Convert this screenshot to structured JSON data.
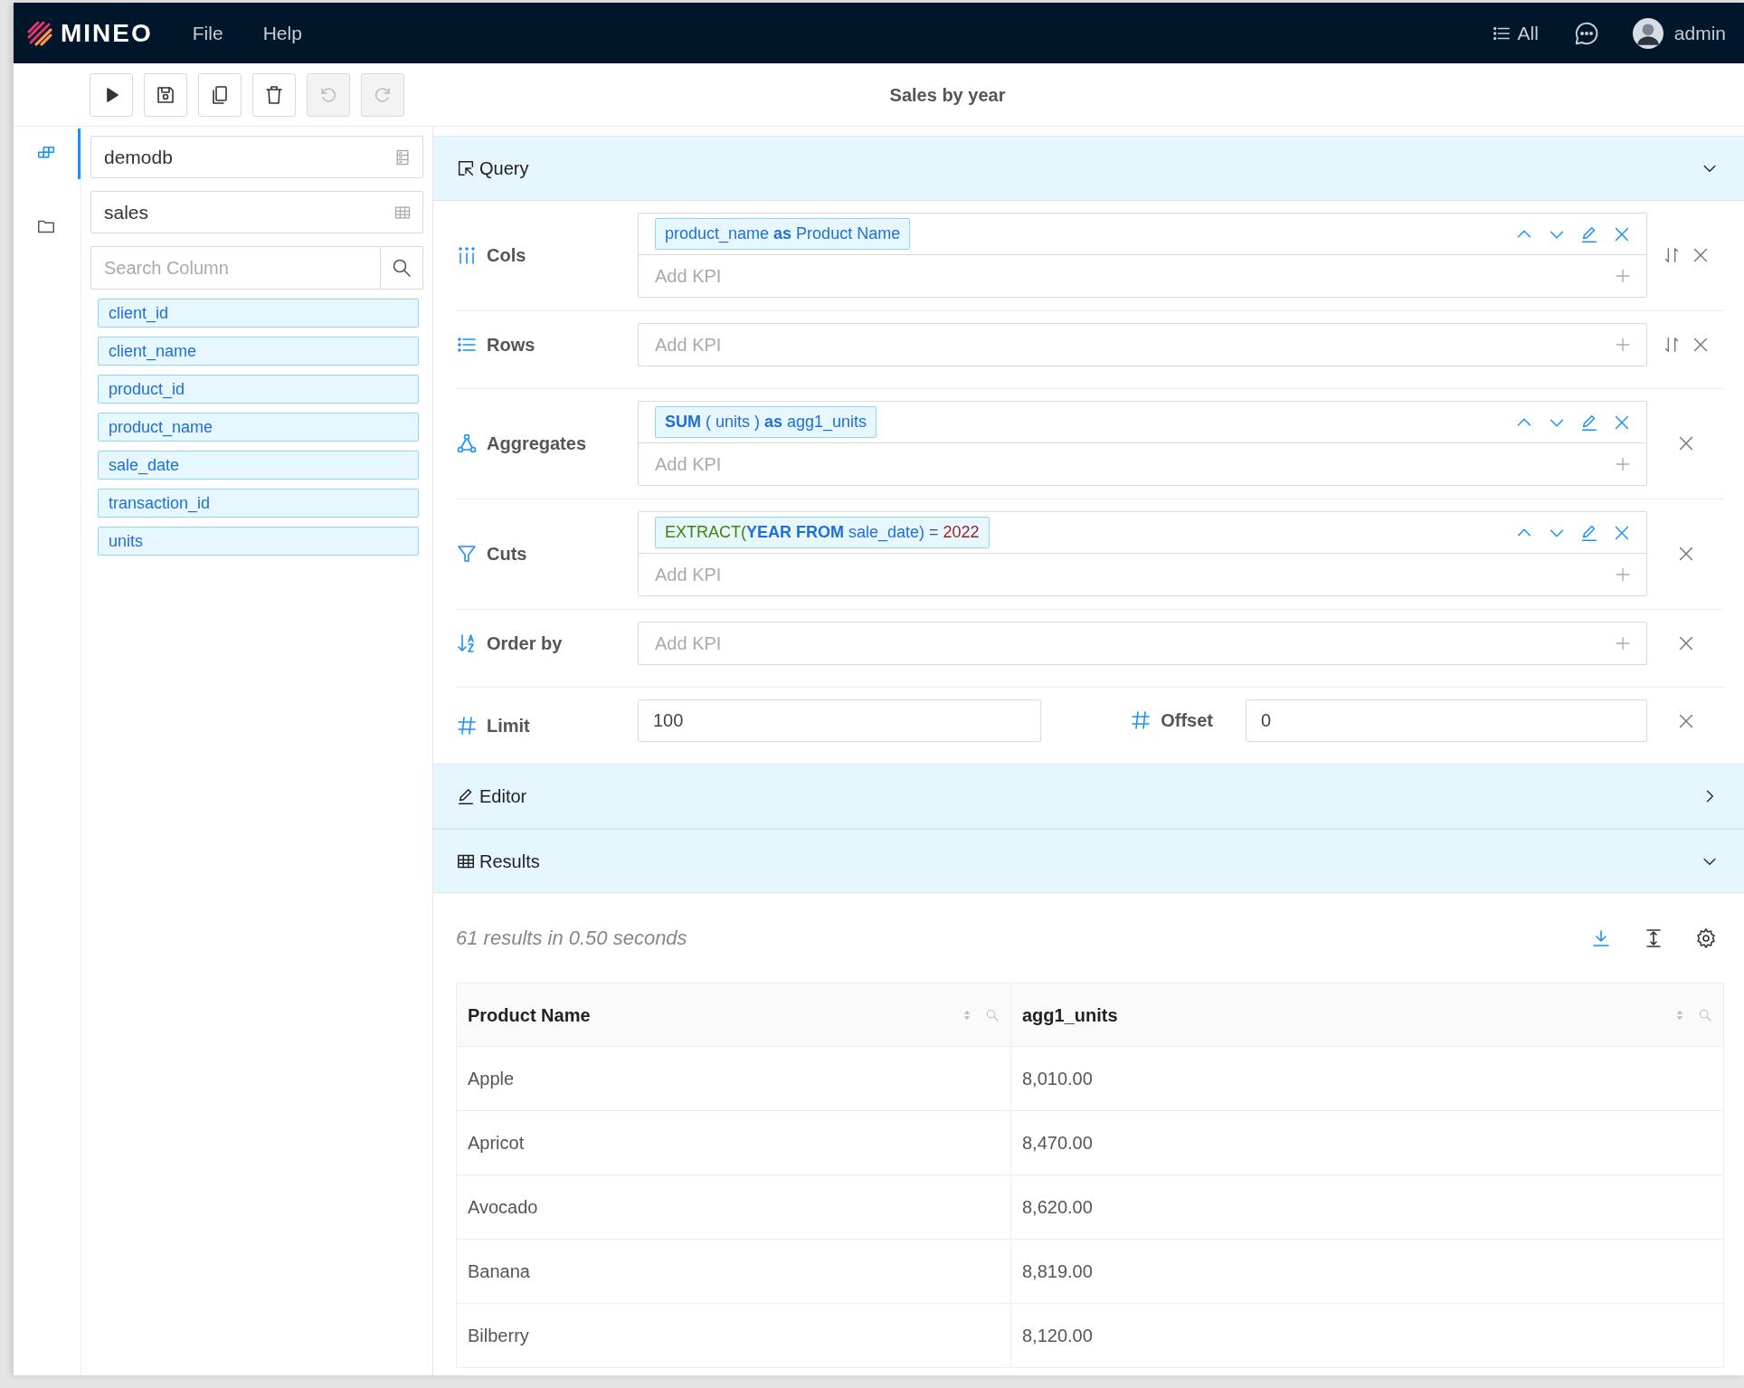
{
  "navbar": {
    "logo": "MINEO",
    "menu": [
      {
        "label": "File"
      },
      {
        "label": "Help"
      }
    ],
    "filter": "All",
    "user": "admin"
  },
  "toolbar": {
    "buttons": [
      {
        "disabled": false
      },
      {
        "disabled": false
      },
      {
        "disabled": false
      },
      {
        "disabled": false
      },
      {
        "disabled": true
      },
      {
        "disabled": true
      }
    ],
    "title": "Sales by year"
  },
  "rail": [
    {
      "selected": true
    },
    {
      "selected": false
    }
  ],
  "source": {
    "database": "demodb",
    "table": "sales",
    "search_placeholder": "Search Column",
    "columns": [
      "client_id",
      "client_name",
      "product_id",
      "product_name",
      "sale_date",
      "transaction_id",
      "units"
    ]
  },
  "query": {
    "title": "Query",
    "expanded": true,
    "sections": [
      {
        "kind": "kpi",
        "label": "Cols",
        "swappable": true,
        "placeholder": "Add KPI",
        "items": [
          [
            {
              "text": "product_name ",
              "kind": "plain"
            },
            {
              "text": "as",
              "kind": "keyword"
            },
            {
              "text": " Product Name",
              "kind": "plain"
            }
          ]
        ]
      },
      {
        "kind": "kpi",
        "label": "Rows",
        "swappable": true,
        "placeholder": "Add KPI"
      },
      {
        "kind": "kpi",
        "label": "Aggregates",
        "swappable": false,
        "placeholder": "Add KPI",
        "items": [
          [
            {
              "text": "SUM",
              "kind": "keyword"
            },
            {
              "text": " ( units ) ",
              "kind": "plain"
            },
            {
              "text": "as",
              "kind": "keyword"
            },
            {
              "text": " agg1_units",
              "kind": "plain"
            }
          ]
        ]
      },
      {
        "kind": "kpi",
        "label": "Cuts",
        "swappable": false,
        "placeholder": "Add KPI",
        "items": [
          [
            {
              "text": "EXTRACT(",
              "kind": "function"
            },
            {
              "text": "YEAR FROM",
              "kind": "keyword"
            },
            {
              "text": " sale_date) ",
              "kind": "plain"
            },
            {
              "text": "=",
              "kind": "operator"
            },
            {
              "text": " 2022",
              "kind": "number"
            }
          ]
        ]
      },
      {
        "kind": "kpi",
        "label": "Order by",
        "swappable": false,
        "placeholder": "Add KPI"
      },
      {
        "kind": "limit",
        "label": "Limit",
        "value": "100",
        "offset_label": "Offset",
        "offset_value": "0"
      }
    ]
  },
  "editor": {
    "title": "Editor",
    "expanded": false
  },
  "results": {
    "title": "Results",
    "expanded": true,
    "summary": "61 results in 0.50 seconds",
    "columns": [
      "Product Name",
      "agg1_units"
    ],
    "rows": [
      [
        "Apple",
        "8,010.00"
      ],
      [
        "Apricot",
        "8,470.00"
      ],
      [
        "Avocado",
        "8,620.00"
      ],
      [
        "Banana",
        "8,819.00"
      ],
      [
        "Bilberry",
        "8,120.00"
      ]
    ]
  }
}
